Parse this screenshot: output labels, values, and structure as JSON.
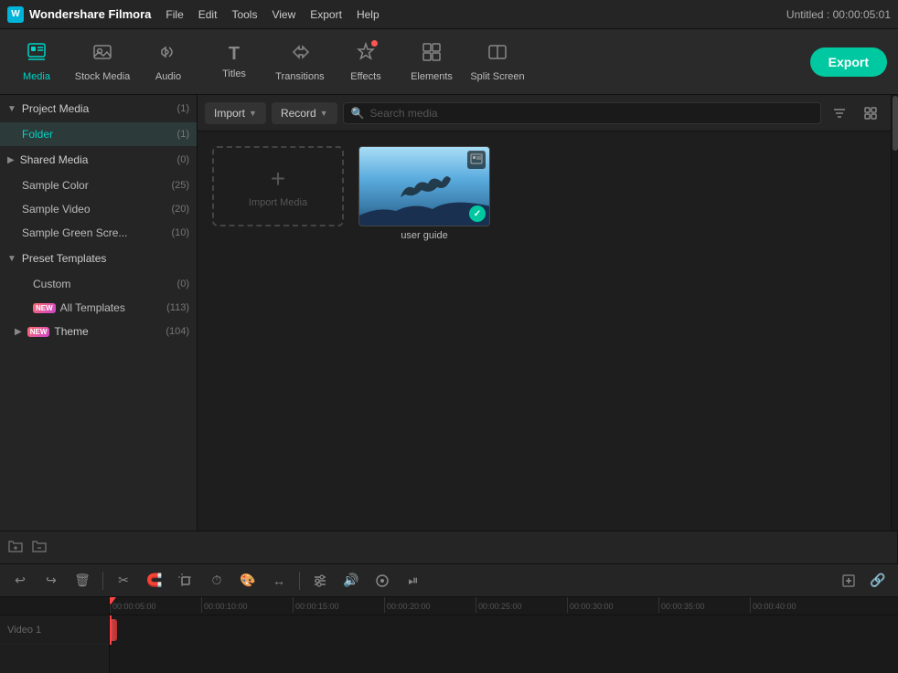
{
  "app": {
    "name": "Wondershare Filmora",
    "logo_text": "W",
    "title": "Untitled : 00:00:05:01"
  },
  "menu": {
    "items": [
      "File",
      "Edit",
      "Tools",
      "View",
      "Export",
      "Help"
    ]
  },
  "toolbar": {
    "buttons": [
      {
        "id": "media",
        "label": "Media",
        "icon": "🖼",
        "active": true
      },
      {
        "id": "stock-media",
        "label": "Stock Media",
        "icon": "📷",
        "active": false
      },
      {
        "id": "audio",
        "label": "Audio",
        "icon": "🎵",
        "active": false
      },
      {
        "id": "titles",
        "label": "Titles",
        "icon": "T",
        "active": false
      },
      {
        "id": "transitions",
        "label": "Transitions",
        "icon": "⟷",
        "active": false
      },
      {
        "id": "effects",
        "label": "Effects",
        "icon": "✨",
        "active": false,
        "dot": true
      },
      {
        "id": "elements",
        "label": "Elements",
        "icon": "◈",
        "active": false
      },
      {
        "id": "split-screen",
        "label": "Split Screen",
        "icon": "⊡",
        "active": false
      }
    ],
    "export_label": "Export"
  },
  "sidebar": {
    "project_media": {
      "label": "Project Media",
      "count": "(1)"
    },
    "folder": {
      "label": "Folder",
      "count": "(1)"
    },
    "shared_media": {
      "label": "Shared Media",
      "count": "(0)"
    },
    "sample_color": {
      "label": "Sample Color",
      "count": "(25)"
    },
    "sample_video": {
      "label": "Sample Video",
      "count": "(20)"
    },
    "sample_green_screen": {
      "label": "Sample Green Scre...",
      "count": "(10)"
    },
    "preset_templates": {
      "label": "Preset Templates"
    },
    "custom": {
      "label": "Custom",
      "count": "(0)"
    },
    "all_templates": {
      "label": "All Templates",
      "count": "(113)"
    },
    "theme": {
      "label": "Theme",
      "count": "(104)"
    }
  },
  "content_toolbar": {
    "import_label": "Import",
    "record_label": "Record",
    "search_placeholder": "Search media",
    "filter_icon": "filter",
    "grid_icon": "grid"
  },
  "media_items": [
    {
      "id": "import",
      "type": "import",
      "label": "Import Media"
    },
    {
      "id": "user-guide",
      "type": "video",
      "label": "user guide"
    }
  ],
  "timeline": {
    "toolbar_icons": [
      "undo",
      "redo",
      "delete",
      "scissors",
      "magnet",
      "crop-frame",
      "speed",
      "color",
      "transform",
      "audio-mixer",
      "volume",
      "effects",
      "playback"
    ],
    "ruler_marks": [
      "00:00:05:00",
      "00:00:10:00",
      "00:00:15:00",
      "00:00:20:00",
      "00:00:25:00",
      "00:00:30:00",
      "00:00:35:00",
      "00:00:40:00"
    ]
  }
}
